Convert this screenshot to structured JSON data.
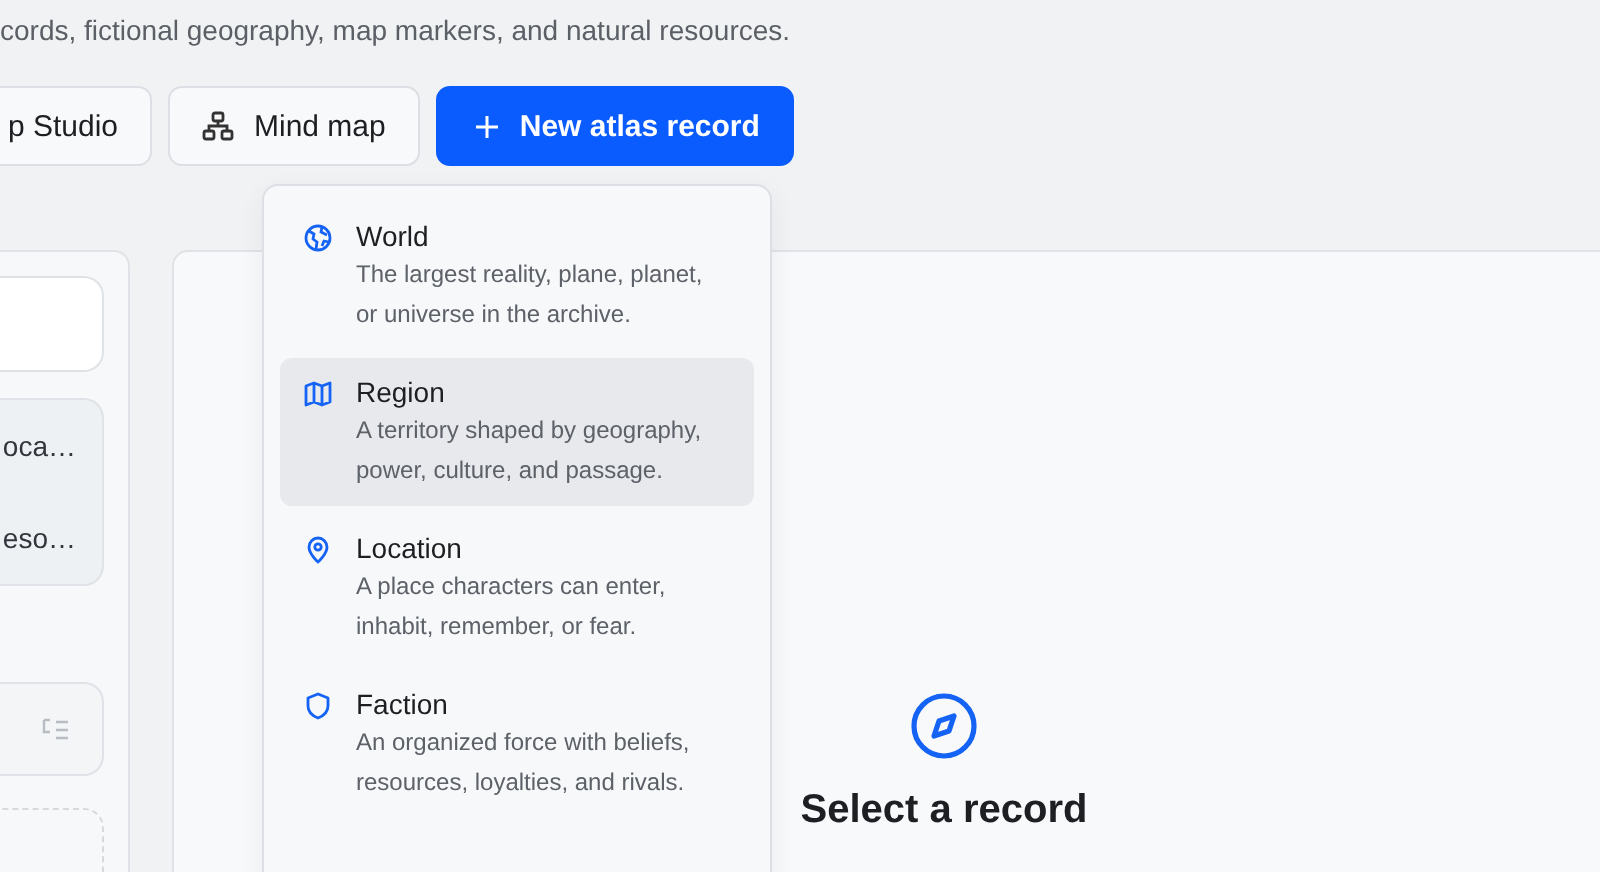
{
  "header": {
    "description": "cords, fictional geography, map markers, and natural resources."
  },
  "toolbar": {
    "buttons": [
      {
        "label": "p Studio",
        "kind": "plain"
      },
      {
        "label": "Mind map",
        "kind": "mindmap"
      },
      {
        "label": "New atlas record",
        "kind": "primary"
      }
    ]
  },
  "sidebar": {
    "list_items": [
      "oca…",
      "eso…"
    ]
  },
  "new_record_menu": {
    "items": [
      {
        "kind": "world",
        "title": "World",
        "description": "The largest reality, plane, planet, or universe in the archive.",
        "selected": false
      },
      {
        "kind": "region",
        "title": "Region",
        "description": "A territory shaped by geography, power, culture, and passage.",
        "selected": true
      },
      {
        "kind": "location",
        "title": "Location",
        "description": "A place characters can enter, inhabit, remember, or fear.",
        "selected": false
      },
      {
        "kind": "faction",
        "title": "Faction",
        "description": "An organized force with beliefs, resources, loyalties, and rivals.",
        "selected": false
      }
    ]
  },
  "detail": {
    "empty_title": "Select a record"
  }
}
